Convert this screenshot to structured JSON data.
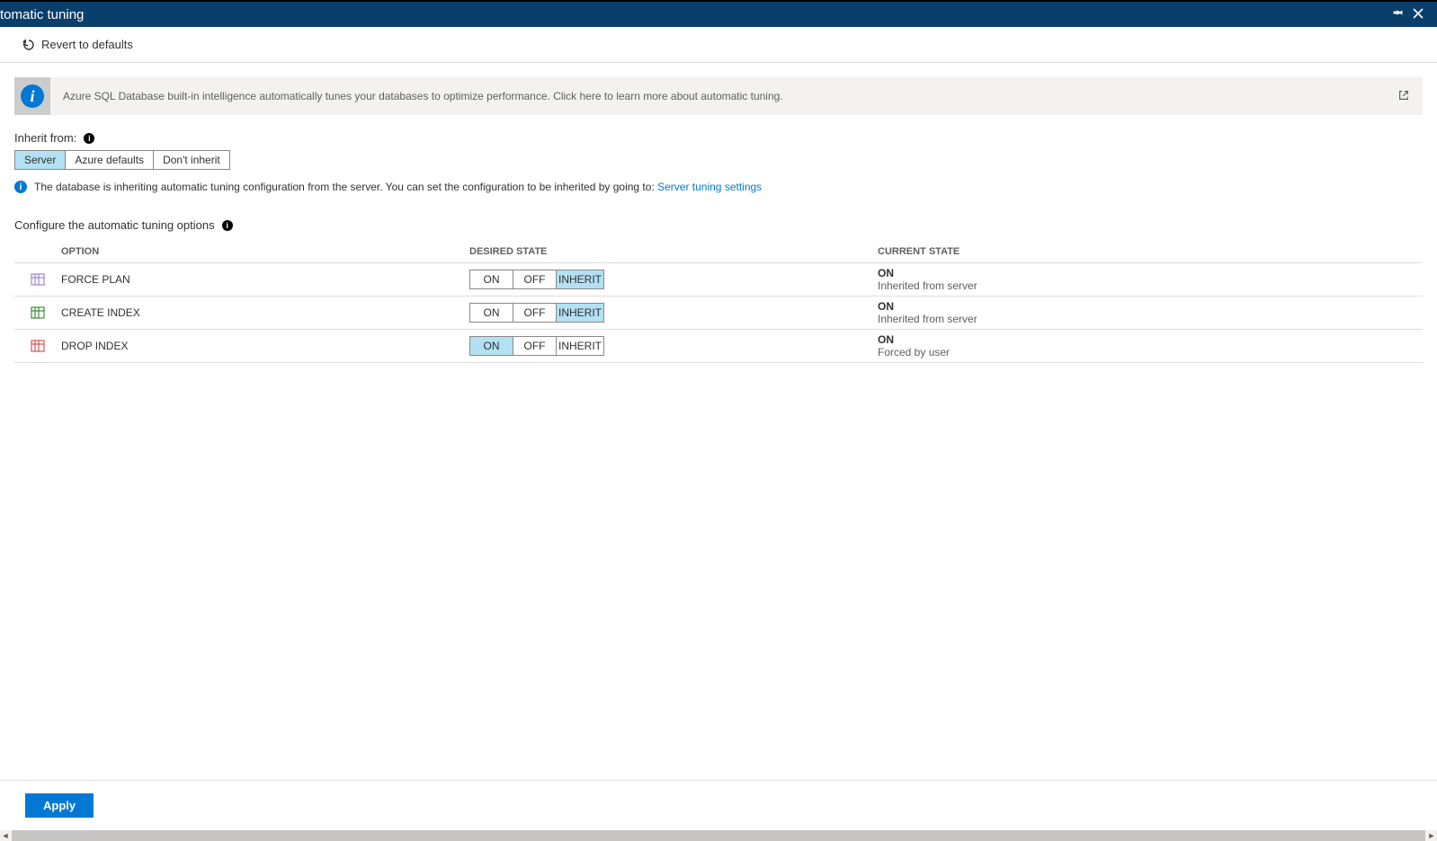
{
  "titlebar": {
    "title": "tomatic tuning"
  },
  "toolbar": {
    "revert_label": "Revert to defaults"
  },
  "banner": {
    "message": "Azure SQL Database built-in intelligence automatically tunes your databases to optimize performance. Click here to learn more about automatic tuning."
  },
  "inherit": {
    "label": "Inherit from:",
    "options": [
      "Server",
      "Azure defaults",
      "Don't inherit"
    ],
    "selected": 0,
    "note_prefix": "The database is inheriting automatic tuning configuration from the server. You can set the configuration to be inherited by going to: ",
    "note_link": "Server tuning settings"
  },
  "configure_label": "Configure the automatic tuning options",
  "columns": {
    "option": "OPTION",
    "desired": "DESIRED STATE",
    "current": "CURRENT STATE"
  },
  "state_labels": [
    "ON",
    "OFF",
    "INHERIT"
  ],
  "options": [
    {
      "name": "FORCE PLAN",
      "icon_color": "#8e6cc8",
      "selected": 2,
      "current_state": "ON",
      "current_source": "Inherited from server"
    },
    {
      "name": "CREATE INDEX",
      "icon_color": "#107c10",
      "selected": 2,
      "current_state": "ON",
      "current_source": "Inherited from server"
    },
    {
      "name": "DROP INDEX",
      "icon_color": "#d13438",
      "selected": 0,
      "current_state": "ON",
      "current_source": "Forced by user"
    }
  ],
  "apply_label": "Apply"
}
